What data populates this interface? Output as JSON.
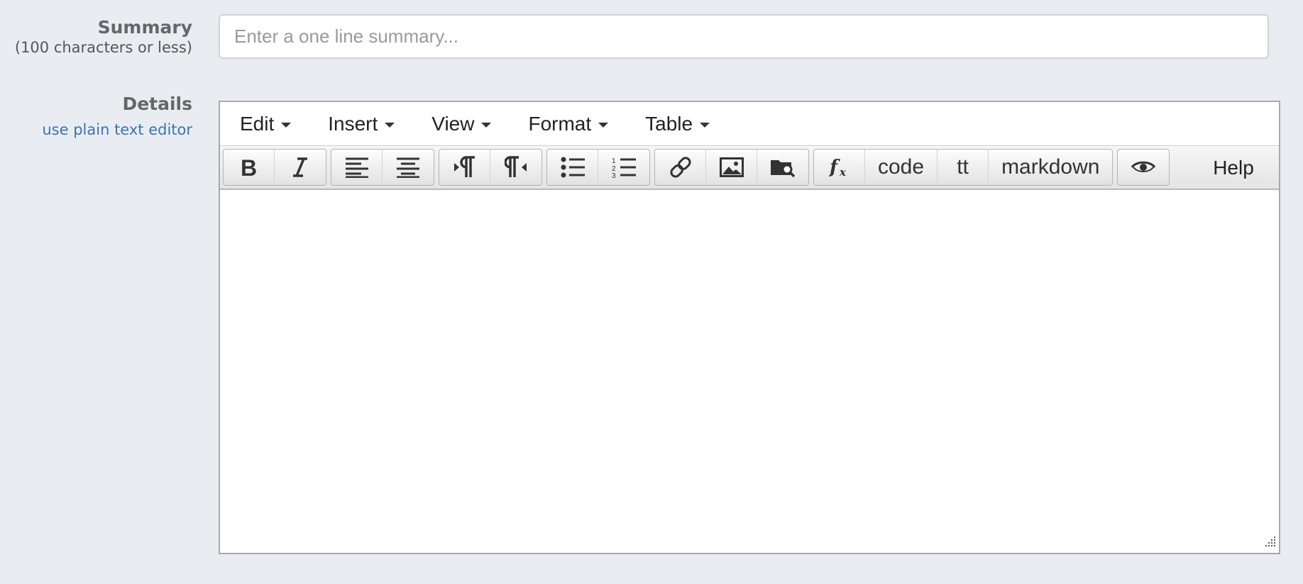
{
  "summary": {
    "label": "Summary",
    "sublabel": "(100 characters or less)",
    "placeholder": "Enter a one line summary...",
    "value": ""
  },
  "details": {
    "label": "Details",
    "plain_text_link": "use plain text editor"
  },
  "editor": {
    "menus": [
      "Edit",
      "Insert",
      "View",
      "Format",
      "Table"
    ],
    "toolbar": {
      "bold": "bold-icon",
      "italic": "italic-icon",
      "align_left": "align-left-icon",
      "align_center": "align-center-icon",
      "ltr": "ltr-icon",
      "rtl": "rtl-icon",
      "bullet_list": "bullet-list-icon",
      "numbered_list": "numbered-list-icon",
      "link": "link-icon",
      "image": "image-icon",
      "browse": "browse-folder-icon",
      "formula": "formula-icon",
      "code_label": "code",
      "tt_label": "tt",
      "markdown_label": "markdown",
      "preview": "eye-icon",
      "help_label": "Help"
    },
    "content": ""
  },
  "colors": {
    "background": "#e9edf2",
    "link": "#3a74b5",
    "label": "#666666"
  }
}
